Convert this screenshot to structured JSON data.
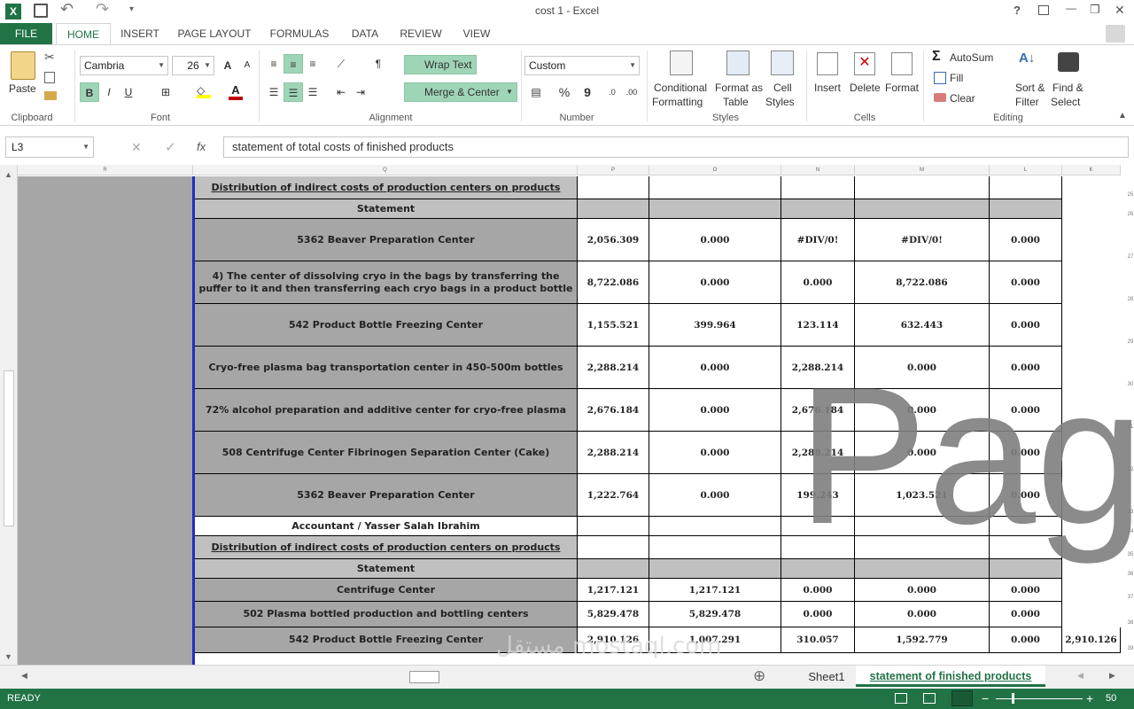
{
  "window": {
    "title": "cost 1 - Excel",
    "help": "?",
    "minimize": "—",
    "restore": "❐",
    "close": "✕"
  },
  "qat": {
    "undo": "↶",
    "redo": "↷"
  },
  "tabs": [
    "FILE",
    "HOME",
    "INSERT",
    "PAGE LAYOUT",
    "FORMULAS",
    "DATA",
    "REVIEW",
    "VIEW"
  ],
  "ribbon": {
    "clipboard": {
      "paste": "Paste",
      "group": "Clipboard"
    },
    "font": {
      "name": "Cambria",
      "size": "26",
      "bold": "B",
      "italic": "I",
      "underline": "U",
      "group": "Font"
    },
    "alignment": {
      "wrap": "Wrap Text",
      "merge": "Merge & Center",
      "group": "Alignment"
    },
    "number": {
      "format": "Custom",
      "percent": "%",
      "comma": "9",
      "group": "Number"
    },
    "styles": {
      "conditional": "Conditional",
      "conditional2": "Formatting",
      "formatas": "Format as",
      "formatas2": "Table",
      "cell": "Cell",
      "cell2": "Styles",
      "group": "Styles"
    },
    "cells": {
      "insert": "Insert",
      "delete": "Delete",
      "format": "Format",
      "group": "Cells"
    },
    "editing": {
      "autosum": "AutoSum",
      "fill": "Fill",
      "clear": "Clear",
      "sort": "Sort &",
      "sort2": "Filter",
      "find": "Find &",
      "find2": "Select",
      "group": "Editing"
    }
  },
  "formula_bar": {
    "name_box": "L3",
    "fx": "fx",
    "value": "statement  of total costs of finished products"
  },
  "columns": [
    "R",
    "Q",
    "P",
    "O",
    "N",
    "M",
    "L",
    "K"
  ],
  "rows": [
    {
      "num": "25",
      "kind": "dist",
      "label": "Distribution of indirect costs of production centers on products",
      "vals": [
        "",
        "",
        "",
        "",
        ""
      ]
    },
    {
      "num": "26",
      "kind": "stmt",
      "label": "Statement",
      "vals": [
        "",
        "",
        "",
        "",
        ""
      ]
    },
    {
      "num": "27",
      "kind": "data",
      "label": "5362 Beaver Preparation Center",
      "vals": [
        "2,056.309",
        "0.000",
        "#DIV/0!",
        "#DIV/0!",
        "0.000"
      ]
    },
    {
      "num": "28",
      "kind": "data",
      "label": "4) The center of dissolving cryo in the bags by transferring the puffer to it and then transferring each cryo bags in a product bottle",
      "vals": [
        "8,722.086",
        "0.000",
        "0.000",
        "8,722.086",
        "0.000"
      ]
    },
    {
      "num": "29",
      "kind": "data",
      "label": "542 Product Bottle Freezing Center",
      "vals": [
        "1,155.521",
        "399.964",
        "123.114",
        "632.443",
        "0.000"
      ]
    },
    {
      "num": "30",
      "kind": "data",
      "label": "Cryo-free plasma bag transportation center in 450-500m bottles",
      "vals": [
        "2,288.214",
        "0.000",
        "2,288.214",
        "0.000",
        "0.000"
      ]
    },
    {
      "num": "31",
      "kind": "data",
      "label": "72% alcohol preparation and additive center for cryo-free plasma",
      "vals": [
        "2,676.184",
        "0.000",
        "2,676.184",
        "0.000",
        "0.000"
      ]
    },
    {
      "num": "32",
      "kind": "data",
      "label": "508 Centrifuge Center Fibrinogen Separation Center (Cake)",
      "vals": [
        "2,288.214",
        "0.000",
        "2,288.214",
        "0.000",
        "0.000"
      ]
    },
    {
      "num": "33",
      "kind": "data",
      "label": "5362 Beaver Preparation Center",
      "vals": [
        "1,222.764",
        "0.000",
        "199.243",
        "1,023.521",
        "0.000"
      ]
    },
    {
      "num": "34",
      "kind": "acct",
      "label": "Accountant / Yasser Salah Ibrahim",
      "vals": [
        "",
        "",
        "",
        "",
        ""
      ]
    },
    {
      "num": "35",
      "kind": "dist",
      "label": "Distribution of indirect costs of production centers on products",
      "vals": [
        "",
        "",
        "",
        "",
        ""
      ]
    },
    {
      "num": "36",
      "kind": "stmt",
      "label": "Statement",
      "vals": [
        "",
        "",
        "",
        "",
        ""
      ]
    },
    {
      "num": "37",
      "kind": "data",
      "label": "Centrifuge Center",
      "vals": [
        "1,217.121",
        "1,217.121",
        "0.000",
        "0.000",
        "0.000"
      ]
    },
    {
      "num": "38",
      "kind": "data",
      "label": "502 Plasma bottled production and bottling centers",
      "vals": [
        "5,829.478",
        "5,829.478",
        "0.000",
        "0.000",
        "0.000"
      ]
    },
    {
      "num": "39",
      "kind": "data",
      "label": "542 Product Bottle Freezing Center",
      "vals": [
        "2,910.126",
        "1,007.291",
        "310.057",
        "1,592.779",
        "0.000"
      ],
      "k": "2,910.126"
    }
  ],
  "watermark": "Pag",
  "sheet_tabs": {
    "tab1": "Sheet1",
    "tab2": "statement of finished products",
    "add": "⊕"
  },
  "status": {
    "ready": "READY",
    "zoom": "50",
    "minus": "−",
    "plus": "+"
  },
  "brand": "مستقل mostaql.com"
}
